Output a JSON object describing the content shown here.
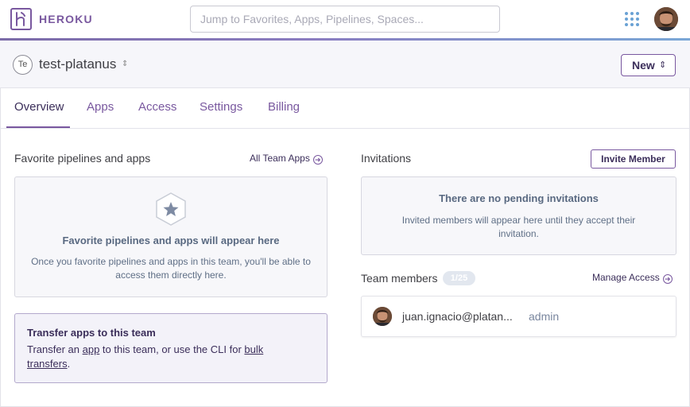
{
  "brand": {
    "name": "HEROKU",
    "color": "#79589f"
  },
  "header": {
    "search_placeholder": "Jump to Favorites, Apps, Pipelines, Spaces...",
    "apps_menu_icon": "grid-icon",
    "avatar_icon": "user-avatar"
  },
  "team": {
    "badge": "Te",
    "name": "test-platanus",
    "new_button": "New"
  },
  "tabs": [
    {
      "label": "Overview",
      "active": true
    },
    {
      "label": "Apps",
      "active": false
    },
    {
      "label": "Access",
      "active": false
    },
    {
      "label": "Settings",
      "active": false
    },
    {
      "label": "Billing",
      "active": false
    }
  ],
  "favorites": {
    "title": "Favorite pipelines and apps",
    "link": "All Team Apps",
    "empty_title": "Favorite pipelines and apps will appear here",
    "empty_desc": "Once you favorite pipelines and apps in this team, you'll be able to access them directly here."
  },
  "transfer": {
    "title": "Transfer apps to this team",
    "text_prefix": "Transfer an ",
    "app_link": "app",
    "text_middle": " to this team, or use the CLI for ",
    "bulk_link": "bulk transfers",
    "text_suffix": "."
  },
  "invitations": {
    "title": "Invitations",
    "invite_button": "Invite Member",
    "empty_title": "There are no pending invitations",
    "empty_desc": "Invited members will appear here until they accept their invitation."
  },
  "members": {
    "title": "Team members",
    "count": "1/25",
    "link": "Manage Access",
    "list": [
      {
        "email": "juan.ignacio@platan...",
        "role": "admin"
      }
    ]
  }
}
